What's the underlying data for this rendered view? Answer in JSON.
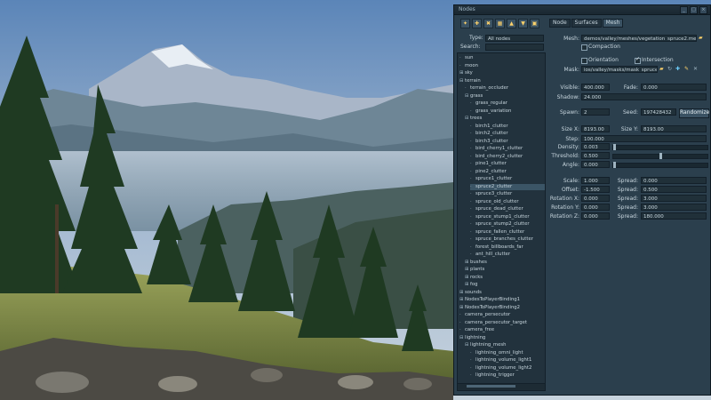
{
  "window": {
    "title": "Nodes",
    "buttons": [
      "_",
      "□",
      "×"
    ]
  },
  "toolbar": {
    "icons": [
      "new-node-icon",
      "clone-node-icon",
      "delete-node-icon",
      "group-icon",
      "move-up-icon",
      "move-down-icon",
      "save-icon"
    ],
    "glyphs": [
      "✦",
      "✚",
      "✖",
      "▦",
      "▲",
      "▼",
      "▣"
    ]
  },
  "filter": {
    "type_label": "Type:",
    "type_value": "All nodes",
    "search_label": "Search:",
    "search_value": ""
  },
  "tree": {
    "items": [
      {
        "label": "sun",
        "indent": 0,
        "expander": ""
      },
      {
        "label": "moon",
        "indent": 0,
        "expander": ""
      },
      {
        "label": "sky",
        "indent": 0,
        "expander": "⊞"
      },
      {
        "label": "terrain",
        "indent": 0,
        "expander": "⊟"
      },
      {
        "label": "terrain_occluder",
        "indent": 1,
        "expander": ""
      },
      {
        "label": "grass",
        "indent": 1,
        "expander": "⊟"
      },
      {
        "label": "grass_regular",
        "indent": 2,
        "expander": ""
      },
      {
        "label": "grass_variation",
        "indent": 2,
        "expander": ""
      },
      {
        "label": "trees",
        "indent": 1,
        "expander": "⊟"
      },
      {
        "label": "birch1_clutter",
        "indent": 2,
        "expander": ""
      },
      {
        "label": "birch2_clutter",
        "indent": 2,
        "expander": ""
      },
      {
        "label": "birch3_clutter",
        "indent": 2,
        "expander": ""
      },
      {
        "label": "bird_cherry1_clutter",
        "indent": 2,
        "expander": ""
      },
      {
        "label": "bird_cherry2_clutter",
        "indent": 2,
        "expander": ""
      },
      {
        "label": "pine1_clutter",
        "indent": 2,
        "expander": ""
      },
      {
        "label": "pine2_clutter",
        "indent": 2,
        "expander": ""
      },
      {
        "label": "spruce1_clutter",
        "indent": 2,
        "expander": ""
      },
      {
        "label": "spruce2_clutter",
        "indent": 2,
        "expander": "",
        "selected": true
      },
      {
        "label": "spruce3_clutter",
        "indent": 2,
        "expander": ""
      },
      {
        "label": "spruce_old_clutter",
        "indent": 2,
        "expander": ""
      },
      {
        "label": "spruce_dead_clutter",
        "indent": 2,
        "expander": ""
      },
      {
        "label": "spruce_stump1_clutter",
        "indent": 2,
        "expander": ""
      },
      {
        "label": "spruce_stump2_clutter",
        "indent": 2,
        "expander": ""
      },
      {
        "label": "spruce_fallen_clutter",
        "indent": 2,
        "expander": ""
      },
      {
        "label": "spruce_branches_clutter",
        "indent": 2,
        "expander": ""
      },
      {
        "label": "forest_billboards_far",
        "indent": 2,
        "expander": ""
      },
      {
        "label": "ant_hill_clutter",
        "indent": 2,
        "expander": ""
      },
      {
        "label": "bushes",
        "indent": 1,
        "expander": "⊞"
      },
      {
        "label": "plants",
        "indent": 1,
        "expander": "⊞"
      },
      {
        "label": "rocks",
        "indent": 1,
        "expander": "⊞"
      },
      {
        "label": "fog",
        "indent": 1,
        "expander": "⊞"
      },
      {
        "label": "sounds",
        "indent": 0,
        "expander": "⊞"
      },
      {
        "label": "NodesToPlayerBinding1",
        "indent": 0,
        "expander": "⊞"
      },
      {
        "label": "NodesToPlayerBinding2",
        "indent": 0,
        "expander": "⊞"
      },
      {
        "label": "camera_persecutor",
        "indent": 0,
        "expander": ""
      },
      {
        "label": "camera_persecutor_target",
        "indent": 0,
        "expander": ""
      },
      {
        "label": "camera_free",
        "indent": 0,
        "expander": ""
      },
      {
        "label": "lightning",
        "indent": 0,
        "expander": "⊟"
      },
      {
        "label": "lightning_mesh",
        "indent": 1,
        "expander": "⊟"
      },
      {
        "label": "lightning_omni_light",
        "indent": 2,
        "expander": ""
      },
      {
        "label": "lightning_volume_light1",
        "indent": 2,
        "expander": ""
      },
      {
        "label": "lightning_volume_light2",
        "indent": 2,
        "expander": ""
      },
      {
        "label": "lightning_trigger",
        "indent": 2,
        "expander": ""
      }
    ]
  },
  "tabs": [
    {
      "label": "Node",
      "active": false
    },
    {
      "label": "Surfaces",
      "active": false
    },
    {
      "label": "Mesh",
      "active": true
    }
  ],
  "props": {
    "mesh_label": "Mesh:",
    "mesh_value": "demos/valley/meshes/vegetation_spruce2.mesh",
    "compaction_label": "Compaction",
    "orientation_label": "Orientation",
    "intersection_label": "Intersection",
    "mask_label": "Mask:",
    "mask_value": "ios/valley/masks/mask_spruce.tga",
    "visible_label": "Visible:",
    "visible_value": "400.000",
    "fade_label": "Fade:",
    "fade_value": "0.000",
    "shadow_label": "Shadow:",
    "shadow_value": "24.000",
    "spawn_label": "Spawn:",
    "spawn_value": "2",
    "seed_label": "Seed:",
    "seed_value": "197428432",
    "randomize_label": "Randomize",
    "sizex_label": "Size X:",
    "sizex_value": "8193.00",
    "sizey_label": "Size Y:",
    "sizey_value": "8193.00",
    "step_label": "Step:",
    "step_value": "100.000",
    "density_label": "Density:",
    "density_value": "0.003",
    "threshold_label": "Threshold:",
    "threshold_value": "0.500",
    "angle_label": "Angle:",
    "angle_value": "0.000",
    "scale_label": "Scale:",
    "scale_value": "1.000",
    "offset_label": "Offset:",
    "offset_value": "-1.500",
    "rotx_label": "Rotation X:",
    "rotx_value": "0.000",
    "roty_label": "Rotation Y:",
    "roty_value": "0.000",
    "rotz_label": "Rotation Z:",
    "rotz_value": "0.000",
    "spread_label": "Spread:",
    "spread_scale": "0.000",
    "spread_offset": "0.500",
    "spread_rotx": "3.000",
    "spread_roty": "3.000",
    "spread_rotz": "180.000"
  },
  "colors": {
    "panel_bg": "#2b3f4d",
    "field_bg": "#203039",
    "accent": "#ffd36b"
  }
}
